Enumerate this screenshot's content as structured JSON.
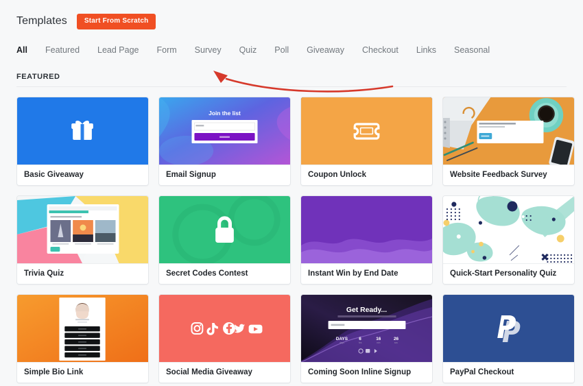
{
  "header": {
    "title": "Templates",
    "scratch_button": "Start From Scratch"
  },
  "tabs": [
    {
      "label": "All",
      "active": true
    },
    {
      "label": "Featured",
      "active": false
    },
    {
      "label": "Lead Page",
      "active": false
    },
    {
      "label": "Form",
      "active": false
    },
    {
      "label": "Survey",
      "active": false
    },
    {
      "label": "Quiz",
      "active": false
    },
    {
      "label": "Poll",
      "active": false
    },
    {
      "label": "Giveaway",
      "active": false
    },
    {
      "label": "Checkout",
      "active": false
    },
    {
      "label": "Links",
      "active": false
    },
    {
      "label": "Seasonal",
      "active": false
    }
  ],
  "section": {
    "title": "FEATURED"
  },
  "templates": [
    {
      "name": "Basic Giveaway",
      "art": "gift",
      "bg": "#2079e8"
    },
    {
      "name": "Email Signup",
      "art": "email",
      "bg": "#5a6fe0",
      "caption": "Join the list"
    },
    {
      "name": "Coupon Unlock",
      "art": "coupon",
      "bg": "#f5a council"
    },
    {
      "name": "Website Feedback Survey",
      "art": "desk-photo",
      "bg": "#e89a3c"
    },
    {
      "name": "Trivia Quiz",
      "art": "trivia",
      "bg": "#ffffff"
    },
    {
      "name": "Secret Codes Contest",
      "art": "lock",
      "bg": "#2ec27e"
    },
    {
      "name": "Instant Win by End Date",
      "art": "waves",
      "bg": "#7032ba"
    },
    {
      "name": "Quick-Start Personality Quiz",
      "art": "blobs",
      "bg": "#ffffff"
    },
    {
      "name": "Simple Bio Link",
      "art": "bio",
      "bg": "#f58220"
    },
    {
      "name": "Social Media Giveaway",
      "art": "social",
      "bg": "#f5695f"
    },
    {
      "name": "Coming Soon Inline Signup",
      "art": "coming-soon",
      "bg": "#14111e",
      "caption": "Get Ready..."
    },
    {
      "name": "PayPal Checkout",
      "art": "paypal",
      "bg": "#2d4f93"
    }
  ],
  "annotation": {
    "type": "curved-arrow",
    "color": "#d6392b",
    "points_to_tab": "Quiz"
  },
  "colors": {
    "accent": "#f04f23",
    "page_bg": "#f7f8f9",
    "text": "#22262b",
    "muted_text": "#72787e",
    "annotation": "#d6392b"
  }
}
